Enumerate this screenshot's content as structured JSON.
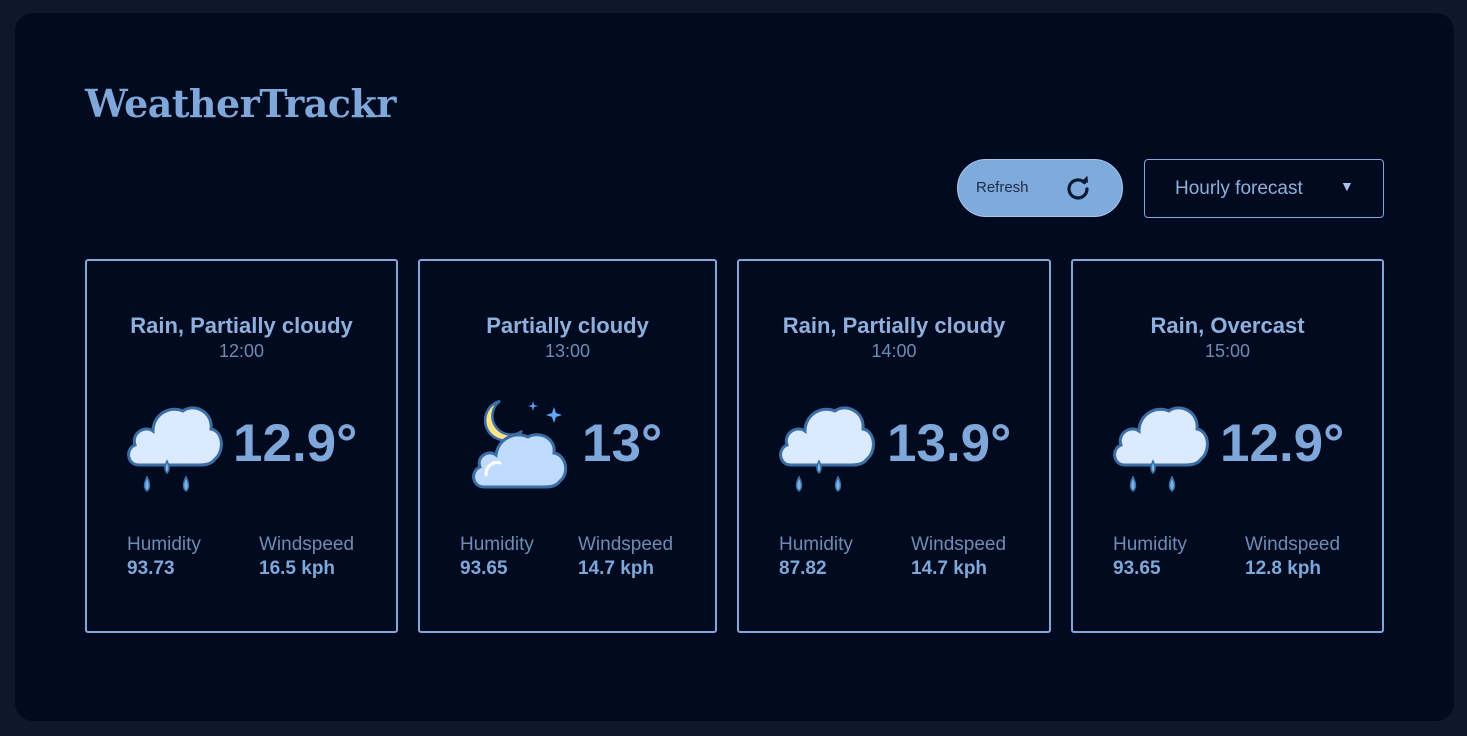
{
  "app": {
    "title": "WeatherTrackr"
  },
  "controls": {
    "refresh_label": "Refresh",
    "forecast_select_value": "Hourly forecast"
  },
  "cards": [
    {
      "condition": "Rain, Partially cloudy",
      "time": "12:00",
      "icon": "rain-cloud-icon",
      "temp": "12.9°",
      "humidity_label": "Humidity",
      "humidity": "93.73",
      "windspeed_label": "Windspeed",
      "windspeed": "16.5 kph"
    },
    {
      "condition": "Partially cloudy",
      "time": "13:00",
      "icon": "moon-cloud-icon",
      "temp": "13°",
      "humidity_label": "Humidity",
      "humidity": "93.65",
      "windspeed_label": "Windspeed",
      "windspeed": "14.7 kph"
    },
    {
      "condition": "Rain, Partially cloudy",
      "time": "14:00",
      "icon": "rain-cloud-icon",
      "temp": "13.9°",
      "humidity_label": "Humidity",
      "humidity": "87.82",
      "windspeed_label": "Windspeed",
      "windspeed": "14.7 kph"
    },
    {
      "condition": "Rain, Overcast",
      "time": "15:00",
      "icon": "rain-cloud-icon",
      "temp": "12.9°",
      "humidity_label": "Humidity",
      "humidity": "93.65",
      "windspeed_label": "Windspeed",
      "windspeed": "12.8 kph"
    }
  ],
  "colors": {
    "background": "#0f172a",
    "panel": "#020a1f",
    "accent": "#7fa7d9"
  }
}
